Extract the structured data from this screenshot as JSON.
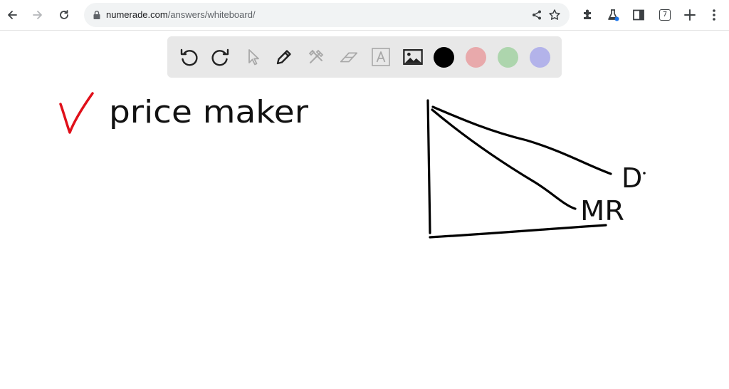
{
  "browser": {
    "url_host": "numerade.com",
    "url_path": "/answers/whiteboard/",
    "tab_count": "7"
  },
  "toolbar": {
    "tools": [
      "undo-icon",
      "redo-icon",
      "pointer-icon",
      "pen-icon",
      "tools-icon",
      "eraser-icon",
      "text-icon",
      "image-icon"
    ],
    "colors": {
      "black": "#000000",
      "red": "#e8a9ab",
      "green": "#add5ad",
      "purple": "#b3b3ea"
    }
  },
  "whiteboard": {
    "checkmark_color": "#e0101a",
    "heading": "price maker",
    "label_demand": "D",
    "label_mr": "MR"
  }
}
